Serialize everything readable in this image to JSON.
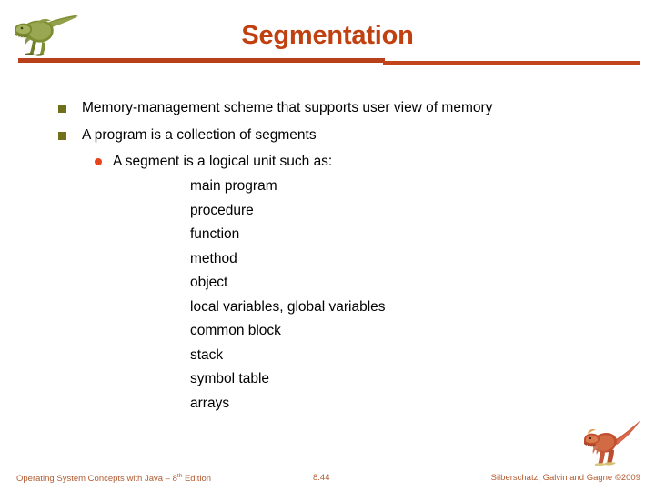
{
  "slide": {
    "title": "Segmentation",
    "theme": {
      "title_color": "#C1400F",
      "rule_color": "#B8401A",
      "square_bullet_color": "#70701A",
      "dot_bullet_color": "#E8431A",
      "footer_color": "#B25B31",
      "body_text_color": "#000000",
      "background": "#FFFFFF"
    }
  },
  "bullets": [
    {
      "level": 1,
      "text": "Memory-management scheme that supports user view of memory"
    },
    {
      "level": 1,
      "text": "A program is a collection of segments"
    },
    {
      "level": 2,
      "text": "A segment is a logical unit such as:"
    },
    {
      "level": 3,
      "text": "main program"
    },
    {
      "level": 3,
      "text": "procedure"
    },
    {
      "level": 3,
      "text": "function"
    },
    {
      "level": 3,
      "text": "method"
    },
    {
      "level": 3,
      "text": "object"
    },
    {
      "level": 3,
      "text": "local variables, global variables"
    },
    {
      "level": 3,
      "text": "common block"
    },
    {
      "level": 3,
      "text": "stack"
    },
    {
      "level": 3,
      "text": "symbol table"
    },
    {
      "level": 3,
      "text": "arrays"
    }
  ],
  "footer": {
    "left_prefix": "Operating System Concepts  with Java – 8",
    "left_superscript": "th",
    "left_suffix": " Edition",
    "page_number": "8.44",
    "right": "Silberschatz, Galvin and Gagne ©2009"
  },
  "icons": {
    "header_logo": "dinosaur-green-icon",
    "footer_logo": "dinosaur-red-icon"
  }
}
